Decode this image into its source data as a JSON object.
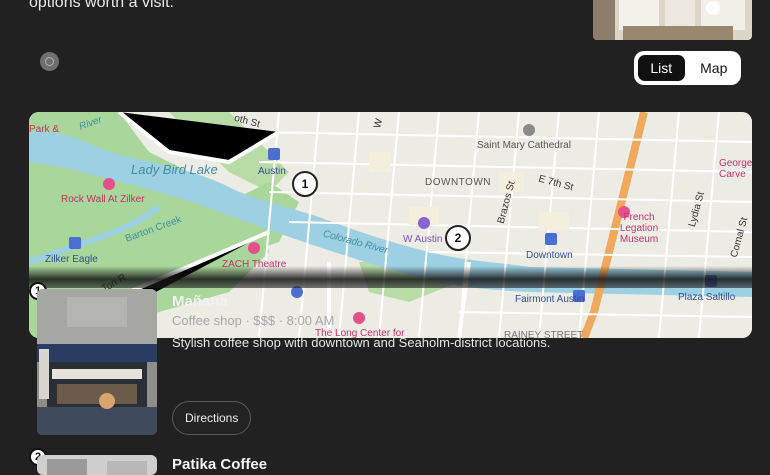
{
  "intro_text": "options worth a visit:",
  "view_toggle": {
    "list_label": "List",
    "map_label": "Map",
    "active": "List"
  },
  "map": {
    "labels": [
      {
        "key": "lady_bird_lake",
        "text": "Lady Bird Lake",
        "color": "#3f8fa5"
      },
      {
        "key": "rock_wall",
        "text": "Rock Wall At Zilker",
        "color": "#c2326a"
      },
      {
        "key": "zilker_eagle",
        "text": "Zilker Eagle",
        "color": "#2f4f9a"
      },
      {
        "key": "barton_creek",
        "text": "Barton Creek",
        "color": "#3f8fa5"
      },
      {
        "key": "austin",
        "text": "Austin",
        "color": "#2f4f9a"
      },
      {
        "key": "zach",
        "text": "ZACH Theatre",
        "color": "#c2326a"
      },
      {
        "key": "colorado_river",
        "text": "Colorado River",
        "color": "#3f8fa5"
      },
      {
        "key": "downtown",
        "text": "DOWNTOWN",
        "color": "#555"
      },
      {
        "key": "saint_mary",
        "text": "Saint Mary Cathedral",
        "color": "#555"
      },
      {
        "key": "e7th",
        "text": "E 7th St",
        "color": "#333"
      },
      {
        "key": "brazos",
        "text": "Brazos St",
        "color": "#333"
      },
      {
        "key": "w_austin",
        "text": "W Austin",
        "color": "#7b4fbf"
      },
      {
        "key": "downtown_station",
        "text": "Downtown",
        "color": "#2f4f9a"
      },
      {
        "key": "french_legation",
        "text": "French Legation Museum",
        "color": "#c2326a"
      },
      {
        "key": "lydia",
        "text": "Lydia St",
        "color": "#333"
      },
      {
        "key": "comal",
        "text": "Comal St",
        "color": "#333"
      },
      {
        "key": "george",
        "text": "George Carve",
        "color": "#c2326a"
      },
      {
        "key": "fairmont",
        "text": "Fairmont Austin",
        "color": "#2f4f9a"
      },
      {
        "key": "plaza_saltillo",
        "text": "Plaza Saltillo",
        "color": "#2f4f9a"
      },
      {
        "key": "long_center",
        "text": "The Long Center for",
        "color": "#c2326a"
      },
      {
        "key": "rainey",
        "text": "RAINEY STREET",
        "color": "#777"
      },
      {
        "key": "river_tl",
        "text": "River",
        "color": "#3f8fa5"
      },
      {
        "key": "st_top",
        "text": "oth St",
        "color": "#333"
      },
      {
        "key": "w_top",
        "text": "W",
        "color": "#333"
      },
      {
        "key": "art",
        "text": "Park &",
        "color": "#c2326a"
      },
      {
        "key": "ton_r",
        "text": "Ton R",
        "color": "#333"
      }
    ],
    "pins": [
      {
        "label": "1"
      },
      {
        "label": "2"
      }
    ]
  },
  "places": [
    {
      "number": "1",
      "name": "Mañana",
      "meta": "Coffee shop · $$$ · 8:00 AM",
      "description": "Stylish coffee shop with downtown and Seaholm-district locations.",
      "directions_label": "Directions"
    },
    {
      "number": "2",
      "name": "Patika Coffee"
    }
  ]
}
